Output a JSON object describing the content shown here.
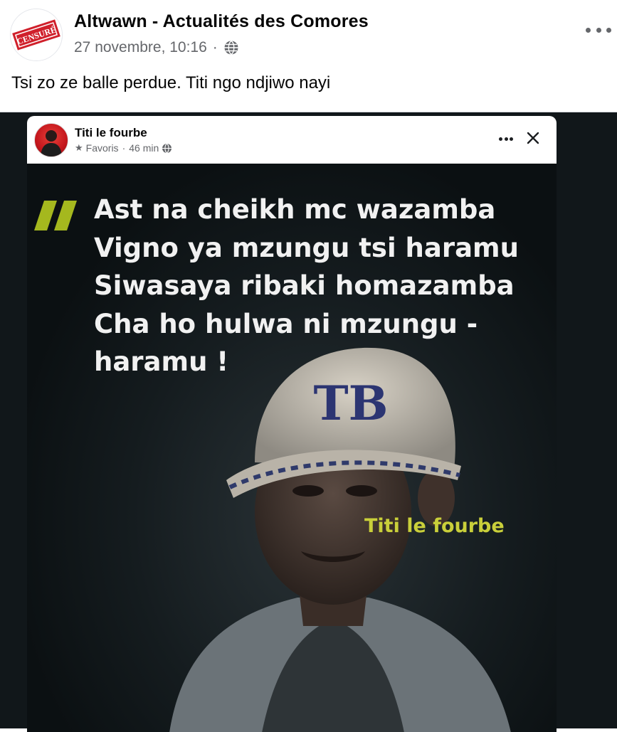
{
  "post": {
    "page_name": "Altwawn - Actualités des Comores",
    "avatar_stamp": "CENSURÉ",
    "date": "27 novembre, 10:16",
    "separator": "·",
    "text": "Tsi zo ze balle perdue. Titi ngo ndjiwo nayi"
  },
  "embedded_post": {
    "author": "Titi le fourbe",
    "badge": "Favoris",
    "separator": "·",
    "time": "46 min",
    "quote_lines": [
      "Ast na cheikh mc  wazamba",
      "Vigno ya mzungu tsi haramu",
      "Siwasaya ribaki homazamba",
      "Cha ho hulwa ni mzungu -",
      "haramu !"
    ],
    "signature": "Titi le fourbe",
    "cap_logo": "TB"
  },
  "icons": {
    "globe": "globe-icon",
    "more": "more-options-icon",
    "close": "close-icon",
    "star": "star-icon",
    "quote": "quote-mark-icon"
  },
  "colors": {
    "accent_quote": "#a5b81e",
    "signature": "#c9cf3a",
    "meta_text": "#65676b",
    "stamp_red": "#d0202b"
  }
}
